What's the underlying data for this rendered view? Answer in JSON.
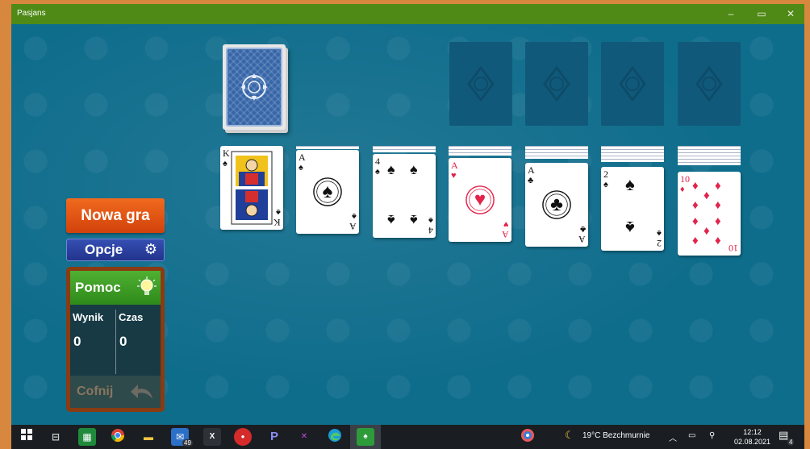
{
  "window": {
    "title": "Pasjans",
    "minimize": "–",
    "maximize": "▭",
    "close": "✕"
  },
  "board": {
    "tableau": [
      {
        "rank": "K",
        "suit": "♠",
        "color": "blk",
        "hidden": 0
      },
      {
        "rank": "A",
        "suit": "♠",
        "color": "blk",
        "hidden": 1
      },
      {
        "rank": "4",
        "suit": "♠",
        "color": "blk",
        "hidden": 2
      },
      {
        "rank": "A",
        "suit": "♥",
        "color": "red",
        "hidden": 3
      },
      {
        "rank": "A",
        "suit": "♣",
        "color": "blk",
        "hidden": 4
      },
      {
        "rank": "2",
        "suit": "♠",
        "color": "blk",
        "hidden": 5
      },
      {
        "rank": "10",
        "suit": "♦",
        "color": "red",
        "hidden": 6
      }
    ]
  },
  "sidebar": {
    "new_game": "Nowa gra",
    "options": "Opcje",
    "help": "Pomoc",
    "score_label": "Wynik",
    "time_label": "Czas",
    "score_value": "0",
    "time_value": "0",
    "undo": "Cofnij"
  },
  "taskbar": {
    "mail_badge": "49",
    "weather": "19°C  Bezchmurnie",
    "time": "12:12",
    "date": "02.08.2021",
    "notif_badge": "4",
    "app_x_label": "X",
    "app_p_label": "P"
  },
  "colors": {
    "felt": "#0f6d8c",
    "titlebar": "#4f8a16",
    "new_game": "#e55a16",
    "options": "#2a3f9f",
    "help": "#3f9e28"
  }
}
